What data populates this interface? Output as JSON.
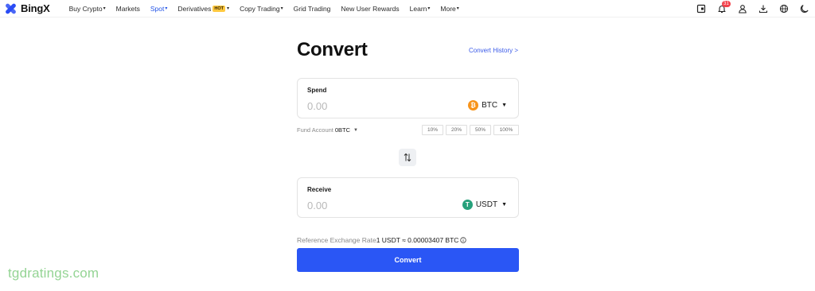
{
  "brand": {
    "name": "BingX"
  },
  "nav": {
    "items": [
      {
        "label": "Buy Crypto",
        "caret": "▾"
      },
      {
        "label": "Markets"
      },
      {
        "label": "Spot",
        "caret": "▾"
      },
      {
        "label": "Derivatives",
        "badge": "HOT",
        "caret": "▾"
      },
      {
        "label": "Copy Trading",
        "caret": "▾"
      },
      {
        "label": "Grid Trading"
      },
      {
        "label": "New User Rewards"
      },
      {
        "label": "Learn",
        "caret": "▾"
      },
      {
        "label": "More",
        "caret": "▾"
      }
    ]
  },
  "toolbar": {
    "icons": [
      "wallet-icon",
      "bell-icon",
      "user-icon",
      "download-icon",
      "globe-icon",
      "moon-icon"
    ],
    "notification_count": "31"
  },
  "convert": {
    "title": "Convert",
    "history_link": "Convert History >",
    "spend": {
      "label": "Spend",
      "placeholder": "0.00",
      "coin": "BTC",
      "coin_icon": "bitcoin-icon"
    },
    "receive": {
      "label": "Receive",
      "placeholder": "0.00",
      "coin": "USDT",
      "coin_icon": "tether-icon"
    },
    "fund_account": {
      "label": "Fund Account",
      "value": "0BTC"
    },
    "percent_options": [
      "10%",
      "20%",
      "50%",
      "100%"
    ],
    "rate": {
      "label": "Reference Exchange Rate",
      "value": "1 USDT ≈ 0.00003407 BTC"
    },
    "button_label": "Convert"
  },
  "watermark": "tgdratings.com",
  "colors": {
    "accent": "#2a56f5",
    "link": "#3a5ae8",
    "btc": "#f7931a",
    "usdt": "#26a17b",
    "hot_badge": "#ffc940",
    "notification": "#f2404a",
    "watermark": "#94d494"
  }
}
